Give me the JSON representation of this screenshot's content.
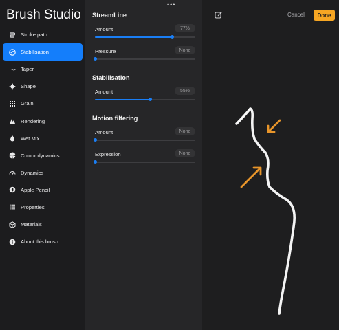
{
  "app": {
    "title": "Brush Studio"
  },
  "sidebar": {
    "items": [
      {
        "label": "Stroke path",
        "icon": "stroke-path-icon",
        "active": false
      },
      {
        "label": "Stabilisation",
        "icon": "stabilisation-icon",
        "active": true
      },
      {
        "label": "Taper",
        "icon": "taper-icon",
        "active": false
      },
      {
        "label": "Shape",
        "icon": "shape-icon",
        "active": false
      },
      {
        "label": "Grain",
        "icon": "grain-icon",
        "active": false
      },
      {
        "label": "Rendering",
        "icon": "rendering-icon",
        "active": false
      },
      {
        "label": "Wet Mix",
        "icon": "wet-mix-icon",
        "active": false
      },
      {
        "label": "Colour dynamics",
        "icon": "colour-dynamics-icon",
        "active": false
      },
      {
        "label": "Dynamics",
        "icon": "dynamics-icon",
        "active": false
      },
      {
        "label": "Apple Pencil",
        "icon": "apple-pencil-icon",
        "active": false
      },
      {
        "label": "Properties",
        "icon": "properties-icon",
        "active": false
      },
      {
        "label": "Materials",
        "icon": "materials-icon",
        "active": false
      },
      {
        "label": "About this brush",
        "icon": "about-icon",
        "active": false
      }
    ]
  },
  "sections": [
    {
      "title": "StreamLine",
      "settings": [
        {
          "label": "Amount",
          "value": "77%",
          "level": 0.77
        },
        {
          "label": "Pressure",
          "value": "None",
          "level": 0
        }
      ]
    },
    {
      "title": "Stabilisation",
      "settings": [
        {
          "label": "Amount",
          "value": "55%",
          "level": 0.55
        }
      ]
    },
    {
      "title": "Motion filtering",
      "settings": [
        {
          "label": "Amount",
          "value": "None",
          "level": 0
        },
        {
          "label": "Expression",
          "value": "None",
          "level": 0
        }
      ]
    }
  ],
  "toolbar": {
    "cancel_label": "Cancel",
    "done_label": "Done",
    "more_icon": "ellipsis-icon",
    "edit_icon": "edit-icon"
  },
  "colors": {
    "accent": "#147efb",
    "done": "#f6a623",
    "arrow": "#e8952a"
  }
}
